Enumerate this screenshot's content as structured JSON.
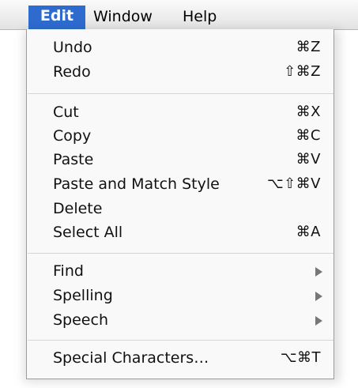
{
  "menubar": {
    "edit": "Edit",
    "window": "Window",
    "help": "Help"
  },
  "menu": {
    "undo": {
      "label": "Undo",
      "shortcut": "⌘Z"
    },
    "redo": {
      "label": "Redo",
      "shortcut": "⇧⌘Z"
    },
    "cut": {
      "label": "Cut",
      "shortcut": "⌘X"
    },
    "copy": {
      "label": "Copy",
      "shortcut": "⌘C"
    },
    "paste": {
      "label": "Paste",
      "shortcut": "⌘V"
    },
    "paste_match": {
      "label": "Paste and Match Style",
      "shortcut": "⌥⇧⌘V"
    },
    "delete": {
      "label": "Delete"
    },
    "select_all": {
      "label": "Select All",
      "shortcut": "⌘A"
    },
    "find": {
      "label": "Find",
      "submenu_icon": "submenu-arrow-icon"
    },
    "spelling": {
      "label": "Spelling",
      "submenu_icon": "submenu-arrow-icon"
    },
    "speech": {
      "label": "Speech",
      "submenu_icon": "submenu-arrow-icon"
    },
    "special_chars": {
      "label": "Special Characters…",
      "shortcut": "⌥⌘T"
    }
  },
  "colors": {
    "highlight": "#2e6bcf",
    "menu_bg": "#f9f9f9"
  }
}
